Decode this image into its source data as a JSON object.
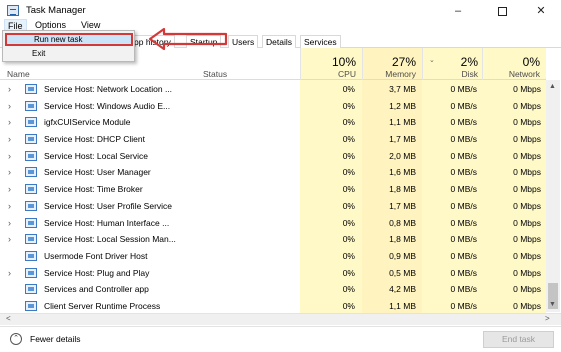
{
  "window": {
    "title": "Task Manager",
    "min": "–",
    "close": "✕"
  },
  "menu": {
    "file": "File",
    "options": "Options",
    "view": "View"
  },
  "file_menu": {
    "run_new_task": "Run new task",
    "exit": "Exit"
  },
  "tabs": {
    "app_history": "pp history",
    "startup": "Startup",
    "users": "Users",
    "details": "Details",
    "services": "Services"
  },
  "columns": {
    "name": "Name",
    "status": "Status",
    "cpu_pct": "10%",
    "cpu": "CPU",
    "memory_pct": "27%",
    "memory": "Memory",
    "disk_pct": "2%",
    "disk": "Disk",
    "network_pct": "0%",
    "network": "Network"
  },
  "processes": [
    {
      "name": "Service Host: Network Location ...",
      "cpu": "0%",
      "memory": "3,7 MB",
      "disk": "0 MB/s",
      "network": "0 Mbps",
      "expandable": true
    },
    {
      "name": "Service Host: Windows Audio E...",
      "cpu": "0%",
      "memory": "1,2 MB",
      "disk": "0 MB/s",
      "network": "0 Mbps",
      "expandable": true
    },
    {
      "name": "igfxCUIService Module",
      "cpu": "0%",
      "memory": "1,1 MB",
      "disk": "0 MB/s",
      "network": "0 Mbps",
      "expandable": true
    },
    {
      "name": "Service Host: DHCP Client",
      "cpu": "0%",
      "memory": "1,7 MB",
      "disk": "0 MB/s",
      "network": "0 Mbps",
      "expandable": true
    },
    {
      "name": "Service Host: Local Service",
      "cpu": "0%",
      "memory": "2,0 MB",
      "disk": "0 MB/s",
      "network": "0 Mbps",
      "expandable": true
    },
    {
      "name": "Service Host: User Manager",
      "cpu": "0%",
      "memory": "1,6 MB",
      "disk": "0 MB/s",
      "network": "0 Mbps",
      "expandable": true
    },
    {
      "name": "Service Host: Time Broker",
      "cpu": "0%",
      "memory": "1,8 MB",
      "disk": "0 MB/s",
      "network": "0 Mbps",
      "expandable": true
    },
    {
      "name": "Service Host: User Profile Service",
      "cpu": "0%",
      "memory": "1,7 MB",
      "disk": "0 MB/s",
      "network": "0 Mbps",
      "expandable": true
    },
    {
      "name": "Service Host: Human Interface ...",
      "cpu": "0%",
      "memory": "0,8 MB",
      "disk": "0 MB/s",
      "network": "0 Mbps",
      "expandable": true
    },
    {
      "name": "Service Host: Local Session Man...",
      "cpu": "0%",
      "memory": "1,8 MB",
      "disk": "0 MB/s",
      "network": "0 Mbps",
      "expandable": true
    },
    {
      "name": "Usermode Font Driver Host",
      "cpu": "0%",
      "memory": "0,9 MB",
      "disk": "0 MB/s",
      "network": "0 Mbps",
      "expandable": false
    },
    {
      "name": "Service Host: Plug and Play",
      "cpu": "0%",
      "memory": "0,5 MB",
      "disk": "0 MB/s",
      "network": "0 Mbps",
      "expandable": true
    },
    {
      "name": "Services and Controller app",
      "cpu": "0%",
      "memory": "4,2 MB",
      "disk": "0 MB/s",
      "network": "0 Mbps",
      "expandable": false
    },
    {
      "name": "Client Server Runtime Process",
      "cpu": "0%",
      "memory": "1,1 MB",
      "disk": "0 MB/s",
      "network": "0 Mbps",
      "expandable": false
    }
  ],
  "footer": {
    "fewer_details": "Fewer details",
    "end_task": "End task"
  },
  "colors": {
    "highlight": "#fff9c8",
    "annotation": "#d23a3a",
    "selection": "#cce4f7"
  },
  "icons": {
    "app": "task-manager-icon",
    "expand": "chevron-right-icon",
    "process": "service-window-icon",
    "fewer": "chevron-up-icon"
  }
}
